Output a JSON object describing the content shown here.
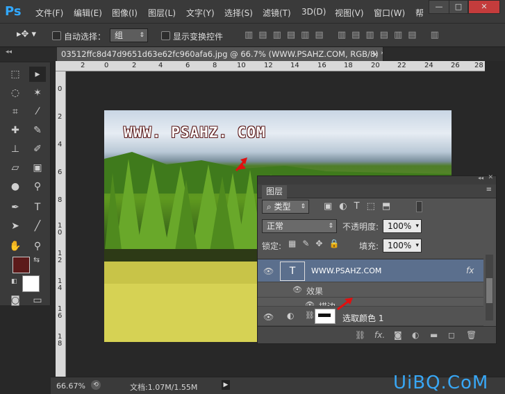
{
  "app": {
    "logo": "Ps"
  },
  "menu": [
    "文件(F)",
    "编辑(E)",
    "图像(I)",
    "图层(L)",
    "文字(Y)",
    "选择(S)",
    "滤镜(T)",
    "3D(D)",
    "视图(V)",
    "窗口(W)",
    "帮"
  ],
  "window_controls": {
    "minimize": "—",
    "maximize": "□",
    "close": "✕"
  },
  "options": {
    "auto_select_label": "自动选择：",
    "auto_select_value": "组",
    "show_transform_label": "显示变换控件"
  },
  "document": {
    "tab_title": "03512ffc8d47d9651d63e62fc960afa6.jpg @ 66.7% (WWW.PSAHZ.COM, RGB/8) *",
    "tab_close": "×",
    "watermark": "WWW. PSAHZ. COM"
  },
  "ruler": {
    "top_labels": [
      "2",
      "0",
      "2",
      "4",
      "6",
      "8",
      "10",
      "12",
      "14",
      "16",
      "18",
      "20",
      "22",
      "24",
      "26",
      "28"
    ],
    "left_labels": [
      "0",
      "2",
      "4",
      "6",
      "8",
      "1 0",
      "1 2",
      "1 4",
      "1 6",
      "1 8"
    ]
  },
  "status": {
    "zoom": "66.67%",
    "doc_info": "文档:1.07M/1.55M"
  },
  "layers_panel": {
    "tab": "图层",
    "filter_kind": "类型",
    "blend_mode": "正常",
    "opacity_label": "不透明度:",
    "opacity_value": "100%",
    "lock_label": "锁定:",
    "fill_label": "填充:",
    "fill_value": "100%",
    "layers": [
      {
        "name": "WWW.PSAHZ.COM",
        "type_glyph": "T",
        "fx": "fx"
      },
      {
        "name": "效果"
      },
      {
        "name": "描边"
      },
      {
        "name": "选取颜色 1"
      }
    ]
  },
  "site_logo": "UiBQ.CoM",
  "colors": {
    "foreground": "#5c1a1a",
    "background": "#ffffff",
    "accent": "#31a8ff",
    "arrow": "#e01010"
  }
}
